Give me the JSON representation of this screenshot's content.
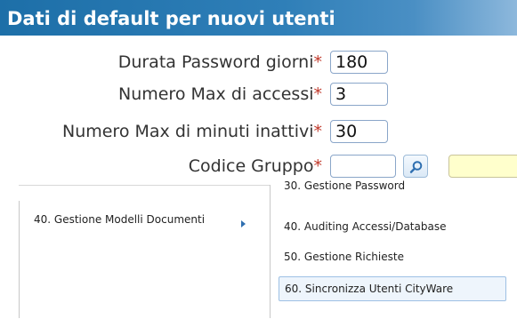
{
  "header": {
    "title": "Dati di default per nuovi utenti"
  },
  "form": {
    "fields": [
      {
        "label": "Durata Password giorni",
        "required_mark": "*",
        "value": "180"
      },
      {
        "label": "Numero Max di accessi",
        "required_mark": "*",
        "value": "3"
      },
      {
        "label": "Numero Max di minuti inattivi",
        "required_mark": "*",
        "value": "30"
      },
      {
        "label": "Codice Gruppo",
        "required_mark": "*",
        "value": ""
      }
    ],
    "lookup_icon": "search-icon"
  },
  "menu": {
    "left_item": "40. Gestione Modelli Documenti",
    "submenu": [
      "30. Gestione Password",
      "40. Auditing Accessi/Database",
      "50. Gestione Richieste",
      "60. Sincronizza Utenti CityWare"
    ]
  },
  "colors": {
    "header_bg": "#1d6fa8",
    "required": "#c0392b",
    "field_border": "#8aa6c9",
    "highlight_bg": "#eef5fc"
  }
}
